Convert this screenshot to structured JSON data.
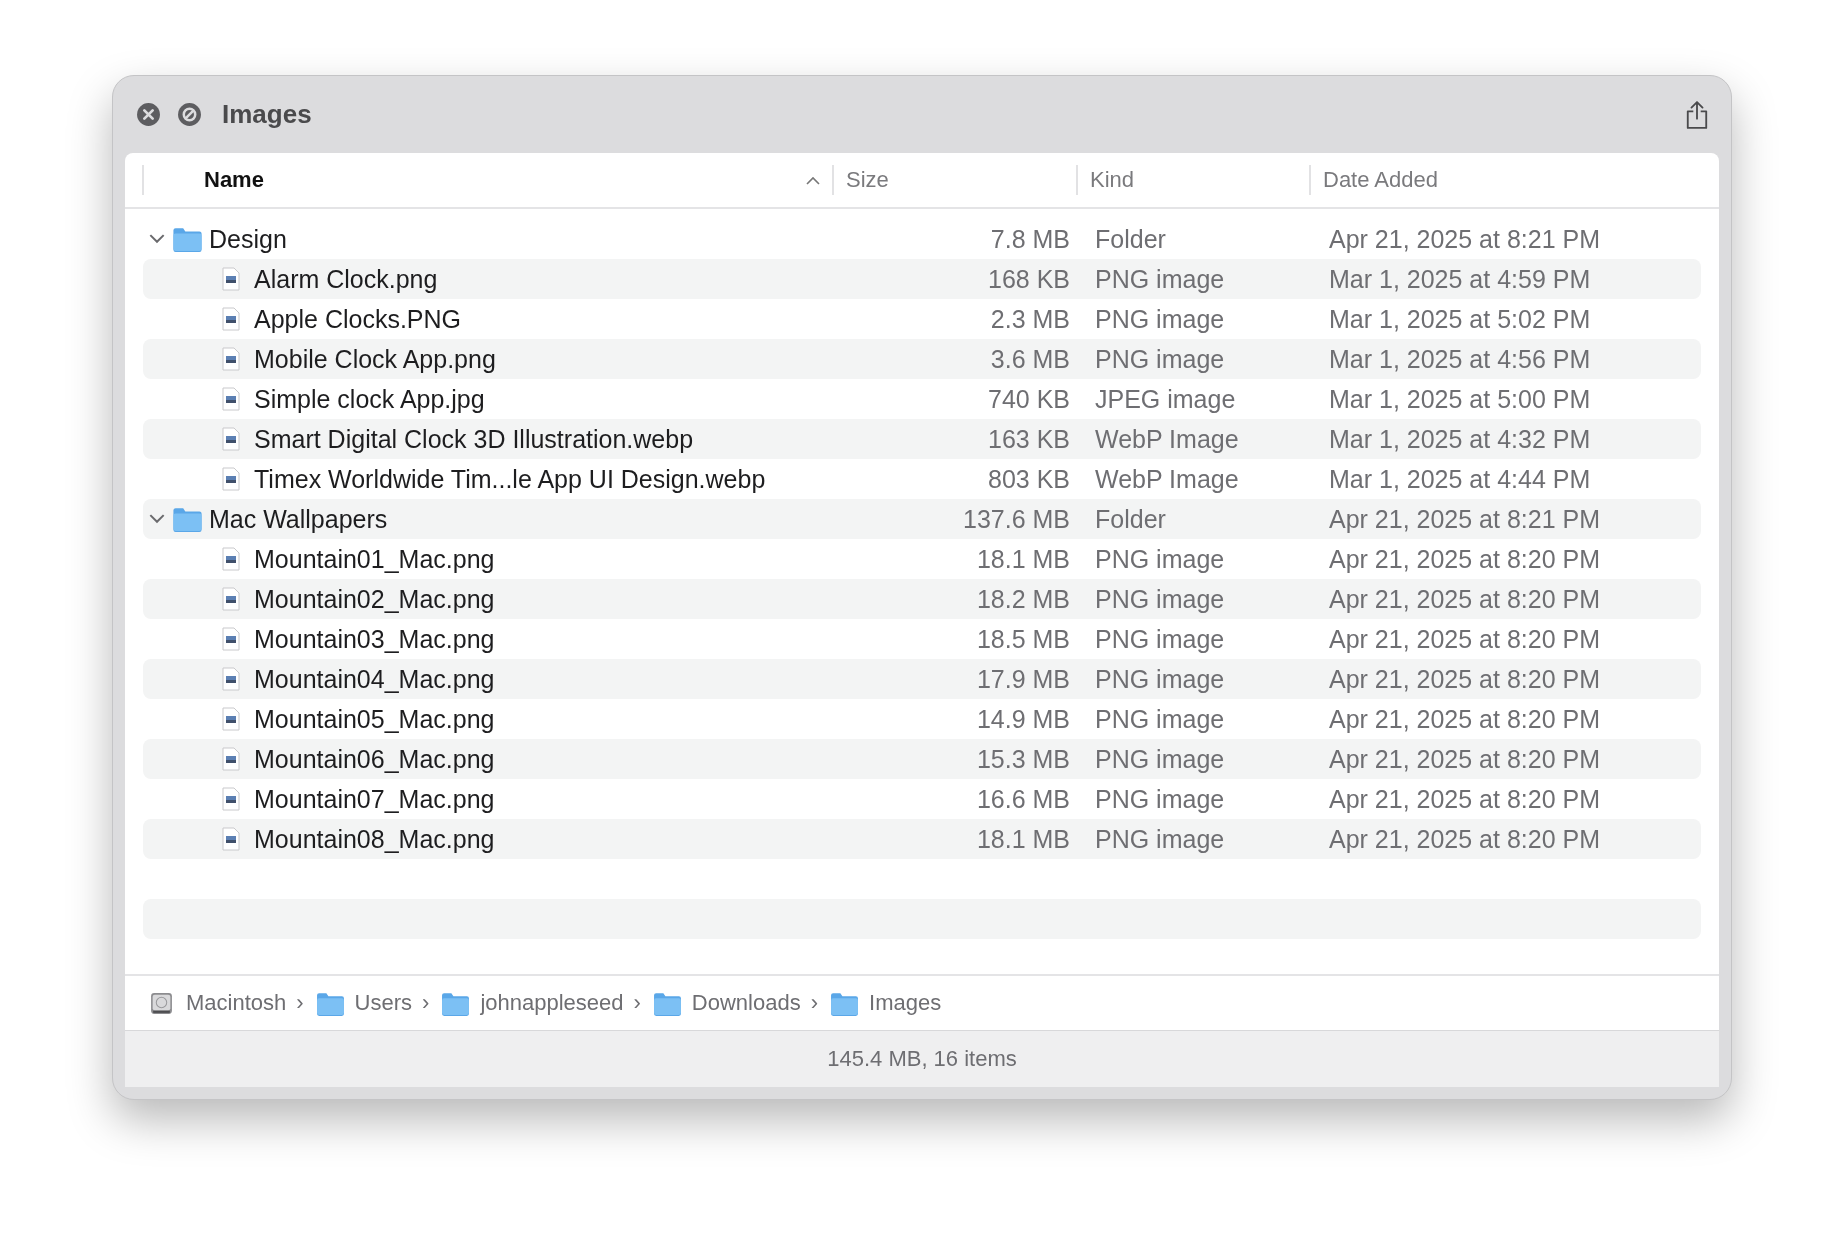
{
  "window": {
    "title": "Images"
  },
  "columns": [
    {
      "label": "Name",
      "selected": true
    },
    {
      "label": "Size",
      "selected": false
    },
    {
      "label": "Kind",
      "selected": false
    },
    {
      "label": "Date Added",
      "selected": false
    }
  ],
  "items": [
    {
      "kind": "folder",
      "name": "Design",
      "size": "7.8 MB",
      "type": "Folder",
      "date": "Apr 21, 2025 at 8:21 PM",
      "expanded": true,
      "children": [
        {
          "kind": "file",
          "name": "Alarm Clock.png",
          "size": "168 KB",
          "type": "PNG image",
          "date": "Mar 1, 2025 at 4:59 PM"
        },
        {
          "kind": "file",
          "name": "Apple Clocks.PNG",
          "size": "2.3 MB",
          "type": "PNG image",
          "date": "Mar 1, 2025 at 5:02 PM"
        },
        {
          "kind": "file",
          "name": "Mobile Clock App.png",
          "size": "3.6 MB",
          "type": "PNG image",
          "date": "Mar 1, 2025 at 4:56 PM"
        },
        {
          "kind": "file",
          "name": "Simple clock App.jpg",
          "size": "740 KB",
          "type": "JPEG image",
          "date": "Mar 1, 2025 at 5:00 PM"
        },
        {
          "kind": "file",
          "name": "Smart Digital Clock 3D Illustration.webp",
          "size": "163 KB",
          "type": "WebP Image",
          "date": "Mar 1, 2025 at 4:32 PM"
        },
        {
          "kind": "file",
          "name": "Timex Worldwide Tim...le App UI Design.webp",
          "size": "803 KB",
          "type": "WebP Image",
          "date": "Mar 1, 2025 at 4:44 PM"
        }
      ]
    },
    {
      "kind": "folder",
      "name": "Mac Wallpapers",
      "size": "137.6 MB",
      "type": "Folder",
      "date": "Apr 21, 2025 at 8:21 PM",
      "expanded": true,
      "children": [
        {
          "kind": "file",
          "name": "Mountain01_Mac.png",
          "size": "18.1 MB",
          "type": "PNG image",
          "date": "Apr 21, 2025 at 8:20 PM"
        },
        {
          "kind": "file",
          "name": "Mountain02_Mac.png",
          "size": "18.2 MB",
          "type": "PNG image",
          "date": "Apr 21, 2025 at 8:20 PM"
        },
        {
          "kind": "file",
          "name": "Mountain03_Mac.png",
          "size": "18.5 MB",
          "type": "PNG image",
          "date": "Apr 21, 2025 at 8:20 PM"
        },
        {
          "kind": "file",
          "name": "Mountain04_Mac.png",
          "size": "17.9 MB",
          "type": "PNG image",
          "date": "Apr 21, 2025 at 8:20 PM"
        },
        {
          "kind": "file",
          "name": "Mountain05_Mac.png",
          "size": "14.9 MB",
          "type": "PNG image",
          "date": "Apr 21, 2025 at 8:20 PM"
        },
        {
          "kind": "file",
          "name": "Mountain06_Mac.png",
          "size": "15.3 MB",
          "type": "PNG image",
          "date": "Apr 21, 2025 at 8:20 PM"
        },
        {
          "kind": "file",
          "name": "Mountain07_Mac.png",
          "size": "16.6 MB",
          "type": "PNG image",
          "date": "Apr 21, 2025 at 8:20 PM"
        },
        {
          "kind": "file",
          "name": "Mountain08_Mac.png",
          "size": "18.1 MB",
          "type": "PNG image",
          "date": "Apr 21, 2025 at 8:20 PM"
        }
      ]
    }
  ],
  "path_bar": [
    {
      "kind": "disk",
      "label": "Macintosh"
    },
    {
      "kind": "folder",
      "label": "Users"
    },
    {
      "kind": "folder",
      "label": "johnappleseed"
    },
    {
      "kind": "folder",
      "label": "Downloads"
    },
    {
      "kind": "folder",
      "label": "Images"
    }
  ],
  "separator": "›",
  "status_bar": "145.4 MB, 16 items"
}
